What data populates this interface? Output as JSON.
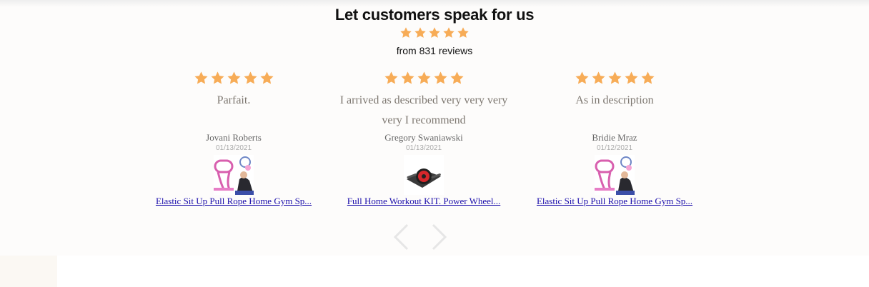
{
  "header": {
    "title": "Let customers speak for us",
    "rating_stars": 5,
    "review_count_text": "from 831 reviews"
  },
  "colors": {
    "star": "#f7ac57",
    "link": "#1a0dab",
    "review_text": "#7d7770",
    "arrow": "#e6e6e6"
  },
  "reviews": [
    {
      "stars": 5,
      "text": "Parfait.",
      "author": "Jovani Roberts",
      "date": "01/13/2021",
      "product_image": "resistance-band-product-thumbnail",
      "product_link": "Elastic Sit Up Pull Rope Home Gym Sp..."
    },
    {
      "stars": 5,
      "text": "I arrived as described very very very very I recommend",
      "author": "Gregory Swaniawski",
      "date": "01/13/2021",
      "product_image": "ab-wheel-product-thumbnail",
      "product_link": "Full Home Workout KIT. Power Wheel..."
    },
    {
      "stars": 5,
      "text": "As in description",
      "author": "Bridie Mraz",
      "date": "01/12/2021",
      "product_image": "resistance-band-product-thumbnail",
      "product_link": "Elastic Sit Up Pull Rope Home Gym Sp..."
    }
  ],
  "carousel": {
    "prev_icon": "chevron-left-icon",
    "next_icon": "chevron-right-icon"
  }
}
